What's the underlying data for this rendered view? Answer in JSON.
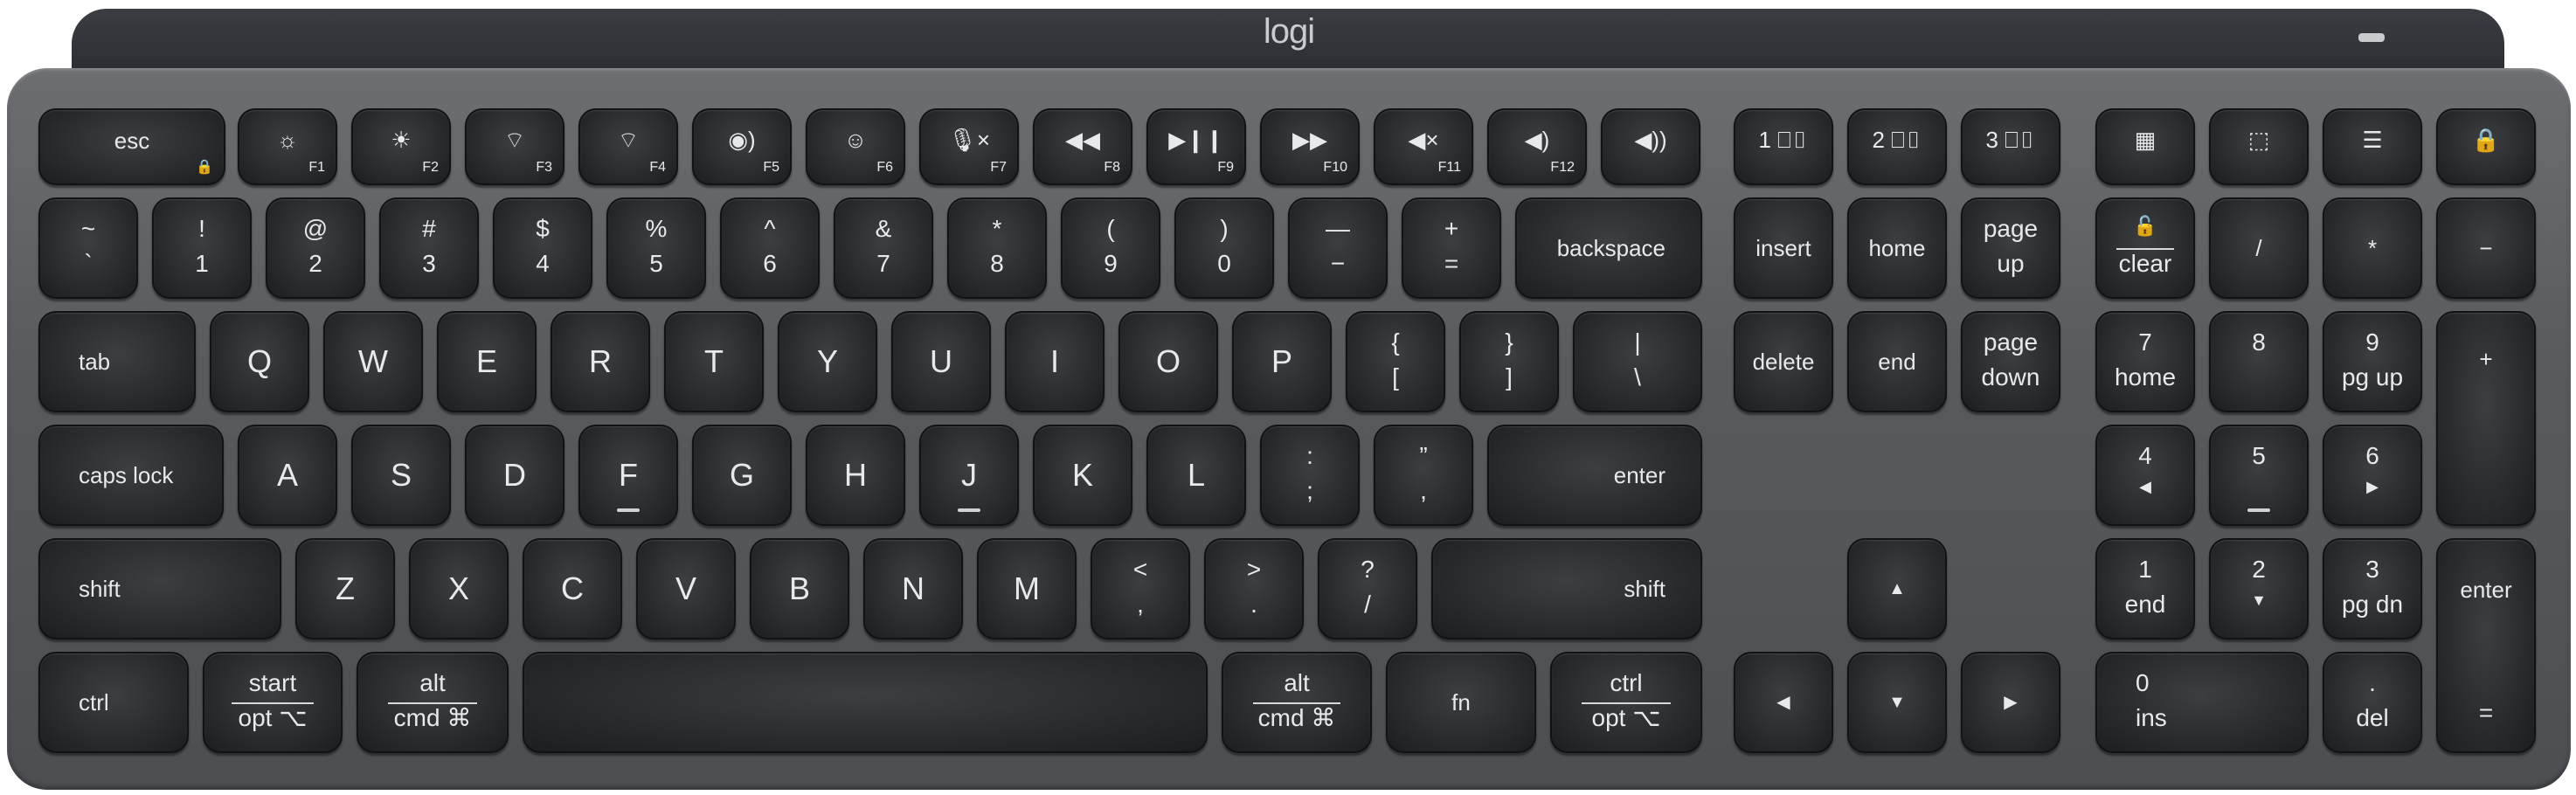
{
  "brand": {
    "logo": "logi"
  },
  "fn_row": [
    {
      "label": "esc",
      "sub": "🔒",
      "icon": "lock-icon"
    },
    {
      "label": "☼",
      "sub": "F1",
      "icon": "brightness-down-icon"
    },
    {
      "label": "☀",
      "sub": "F2",
      "icon": "brightness-up-icon"
    },
    {
      "label": "⌔",
      "sub": "F3",
      "icon": "backlight-down-icon"
    },
    {
      "label": "⌔",
      "sub": "F4",
      "icon": "backlight-up-icon"
    },
    {
      "label": "◉)",
      "sub": "F5",
      "icon": "voice-icon"
    },
    {
      "label": "☺",
      "sub": "F6",
      "icon": "emoji-icon"
    },
    {
      "label": "🎙×",
      "sub": "F7",
      "icon": "mic-mute-icon"
    },
    {
      "label": "◀◀",
      "sub": "F8",
      "icon": "rewind-icon"
    },
    {
      "label": "▶❙❙",
      "sub": "F9",
      "icon": "play-pause-icon"
    },
    {
      "label": "▶▶",
      "sub": "F10",
      "icon": "fast-forward-icon"
    },
    {
      "label": "◀×",
      "sub": "F11",
      "icon": "mute-icon"
    },
    {
      "label": "◀)",
      "sub": "F12",
      "icon": "volume-down-icon"
    },
    {
      "label": "◀))",
      "sub": "",
      "icon": "volume-up-icon"
    },
    {
      "label": "1 ⎕▯",
      "sub": "",
      "icon": "easy-switch-1-icon"
    },
    {
      "label": "2 ⎕▯",
      "sub": "",
      "icon": "easy-switch-2-icon"
    },
    {
      "label": "3 ⎕▯",
      "sub": "",
      "icon": "easy-switch-3-icon"
    },
    {
      "label": "▦",
      "sub": "",
      "icon": "calculator-icon"
    },
    {
      "label": "⬚",
      "sub": "",
      "icon": "screenshot-icon"
    },
    {
      "label": "☰",
      "sub": "",
      "icon": "menu-icon"
    },
    {
      "label": "🔒",
      "sub": "",
      "icon": "lock-screen-icon"
    }
  ],
  "num_row": [
    {
      "top": "~",
      "bot": "`"
    },
    {
      "top": "!",
      "bot": "1"
    },
    {
      "top": "@",
      "bot": "2"
    },
    {
      "top": "#",
      "bot": "3"
    },
    {
      "top": "$",
      "bot": "4"
    },
    {
      "top": "%",
      "bot": "5"
    },
    {
      "top": "^",
      "bot": "6"
    },
    {
      "top": "&",
      "bot": "7"
    },
    {
      "top": "*",
      "bot": "8"
    },
    {
      "top": "(",
      "bot": "9"
    },
    {
      "top": ")",
      "bot": "0"
    },
    {
      "top": "—",
      "bot": "−"
    },
    {
      "top": "+",
      "bot": "="
    },
    {
      "mid": "backspace"
    }
  ],
  "tab_row": [
    {
      "mid": "tab"
    },
    {
      "mid": "Q"
    },
    {
      "mid": "W"
    },
    {
      "mid": "E"
    },
    {
      "mid": "R"
    },
    {
      "mid": "T"
    },
    {
      "mid": "Y"
    },
    {
      "mid": "U"
    },
    {
      "mid": "I"
    },
    {
      "mid": "O"
    },
    {
      "mid": "P"
    },
    {
      "top": "{",
      "bot": "["
    },
    {
      "top": "}",
      "bot": "]"
    },
    {
      "top": "|",
      "bot": "\\"
    }
  ],
  "caps_row": [
    {
      "mid": "caps lock"
    },
    {
      "mid": "A"
    },
    {
      "mid": "S"
    },
    {
      "mid": "D"
    },
    {
      "mid": "F"
    },
    {
      "mid": "G"
    },
    {
      "mid": "H"
    },
    {
      "mid": "J"
    },
    {
      "mid": "K"
    },
    {
      "mid": "L"
    },
    {
      "top": ":",
      "bot": ";"
    },
    {
      "top": "”",
      "bot": ","
    },
    {
      "mid": "enter"
    }
  ],
  "shift_row": [
    {
      "mid": "shift"
    },
    {
      "mid": "Z"
    },
    {
      "mid": "X"
    },
    {
      "mid": "C"
    },
    {
      "mid": "V"
    },
    {
      "mid": "B"
    },
    {
      "mid": "N"
    },
    {
      "mid": "M"
    },
    {
      "top": "<",
      "bot": ","
    },
    {
      "top": ">",
      "bot": "."
    },
    {
      "top": "?",
      "bot": "/"
    },
    {
      "mid": "shift"
    }
  ],
  "bottom_row": [
    {
      "mid": "ctrl"
    },
    {
      "top": "start",
      "bot": "opt ⌥"
    },
    {
      "top": "alt",
      "bot": "cmd ⌘"
    },
    {
      "mid": ""
    },
    {
      "top": "alt",
      "bot": "cmd ⌘"
    },
    {
      "mid": "fn"
    },
    {
      "top": "ctrl",
      "bot": "opt ⌥"
    }
  ],
  "nav_cluster": [
    {
      "mid": "insert"
    },
    {
      "mid": "home"
    },
    {
      "top": "page",
      "bot": "up"
    },
    {
      "mid": "delete"
    },
    {
      "mid": "end"
    },
    {
      "top": "page",
      "bot": "down"
    },
    {
      "mid": "▲"
    },
    {
      "mid": "◀"
    },
    {
      "mid": "▼"
    },
    {
      "mid": "▶"
    }
  ],
  "numpad": [
    {
      "top": "🔓",
      "bot": "clear"
    },
    {
      "mid": "/"
    },
    {
      "mid": "*"
    },
    {
      "mid": "−"
    },
    {
      "top": "7",
      "bot": "home"
    },
    {
      "top": "8",
      "bot": "▲"
    },
    {
      "top": "9",
      "bot": "pg up"
    },
    {
      "mid": "+"
    },
    {
      "top": "4",
      "bot": "◀"
    },
    {
      "top": "5",
      "bot": ""
    },
    {
      "top": "6",
      "bot": "▶"
    },
    {
      "top": "1",
      "bot": "end"
    },
    {
      "top": "2",
      "bot": "▼"
    },
    {
      "top": "3",
      "bot": "pg dn"
    },
    {
      "top": "enter",
      "bot": "="
    },
    {
      "top": "0",
      "bot": "ins"
    },
    {
      "top": ".",
      "bot": "del"
    }
  ]
}
